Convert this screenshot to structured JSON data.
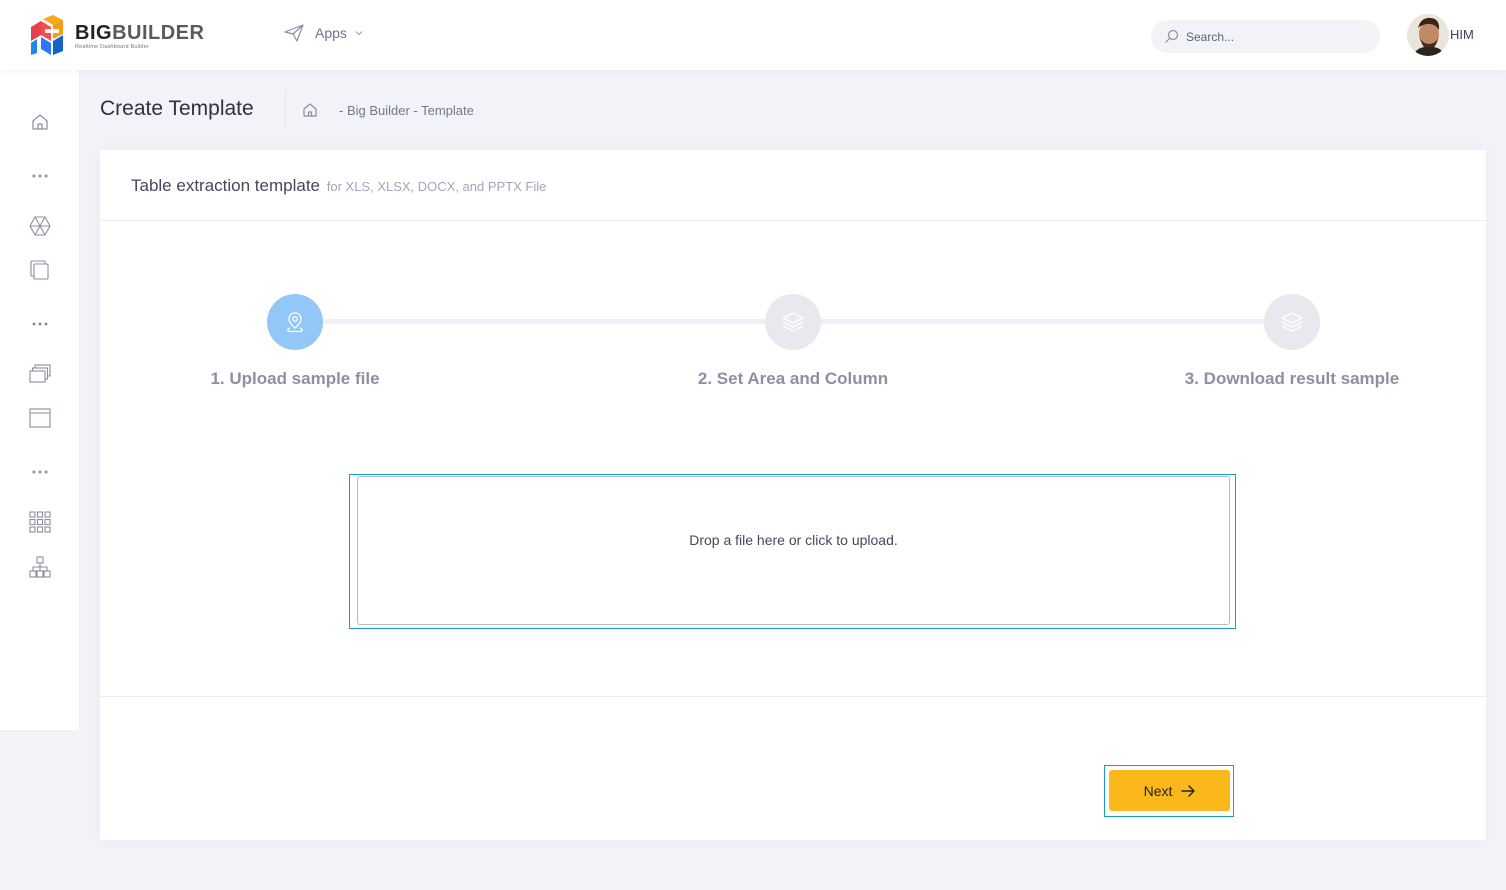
{
  "header": {
    "brand": {
      "big": "BIG",
      "builder": "BUILDER",
      "tagline": "Realtime Dashboard Builder"
    },
    "apps_label": "Apps",
    "search_placeholder": "Search...",
    "user_name": "HIM"
  },
  "sidebar": {
    "items": [
      {
        "icon": "home-icon"
      },
      {
        "icon": "more-dots-icon"
      },
      {
        "icon": "geometry-icon"
      },
      {
        "icon": "documents-icon"
      },
      {
        "icon": "more-dots-icon"
      },
      {
        "icon": "layers-icon"
      },
      {
        "icon": "browser-window-icon"
      },
      {
        "icon": "more-dots-icon"
      },
      {
        "icon": "grid-icon"
      },
      {
        "icon": "hierarchy-icon"
      }
    ]
  },
  "subheader": {
    "title": "Create Template",
    "breadcrumb": "- Big Builder - Template"
  },
  "card": {
    "title": "Table extraction template",
    "subtitle": "for XLS, XLSX, DOCX, and PPTX File"
  },
  "wizard": {
    "steps": [
      {
        "label": "1. Upload sample file",
        "icon": "location-pin-icon",
        "active": true
      },
      {
        "label": "2. Set Area and Column",
        "icon": "layers-icon",
        "active": false
      },
      {
        "label": "3. Download result sample",
        "icon": "layers-icon",
        "active": false
      }
    ]
  },
  "dropzone": {
    "message": "Drop a file here or click to upload."
  },
  "actions": {
    "next_label": "Next"
  },
  "colors": {
    "accent": "#fbb81a",
    "active_step": "#93c7f8",
    "focus_ring": "#1a9bc8"
  }
}
